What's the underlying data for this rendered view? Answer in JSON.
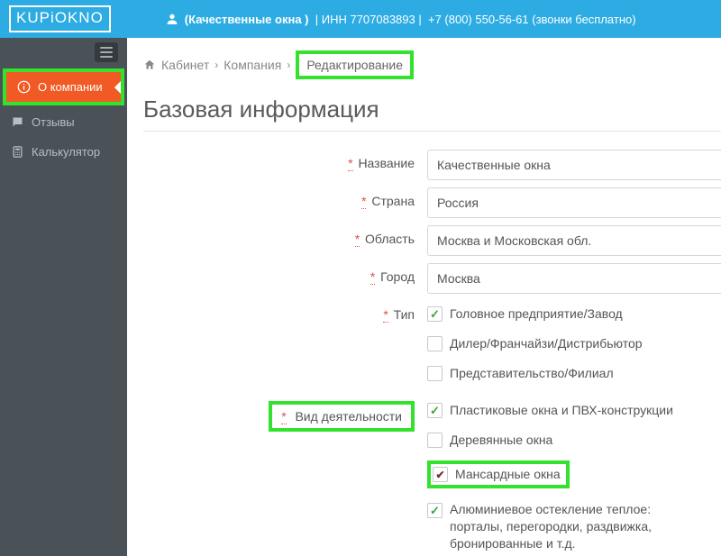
{
  "header": {
    "logo": "KUPiOKNO",
    "company_name": "(Качественные окна )",
    "inn": "ИНН 7707083893",
    "phone": "+7 (800) 550-56-61 (звонки бесплатно)",
    "sep": "|"
  },
  "sidebar": {
    "items": [
      {
        "label": "О компании",
        "icon": "info-icon",
        "active": true
      },
      {
        "label": "Отзывы",
        "icon": "comment-icon",
        "active": false
      },
      {
        "label": "Калькулятор",
        "icon": "calculator-icon",
        "active": false
      }
    ]
  },
  "breadcrumb": {
    "items": [
      "Кабинет",
      "Компания",
      "Редактирование"
    ]
  },
  "page": {
    "title": "Базовая информация"
  },
  "form": {
    "name_label": "Название",
    "name_value": "Качественные окна",
    "country_label": "Страна",
    "country_value": "Россия",
    "region_label": "Область",
    "region_value": "Москва и Московская обл.",
    "city_label": "Город",
    "city_value": "Москва",
    "type_label": "Тип",
    "type_options": [
      {
        "label": "Головное предприятие/Завод",
        "checked": true
      },
      {
        "label": "Дилер/Франчайзи/Дистрибьютор",
        "checked": false
      },
      {
        "label": "Представительство/Филиал",
        "checked": false
      }
    ],
    "activity_label": "Вид деятельности",
    "activity_options": [
      {
        "label": "Пластиковые окна и ПВХ-конструкции",
        "checked": true,
        "highlight": false
      },
      {
        "label": "Деревянные окна",
        "checked": false,
        "highlight": false
      },
      {
        "label": "Мансардные окна",
        "checked": true,
        "highlight": true,
        "brown": true
      },
      {
        "label": "Алюминиевое остекление теплое: порталы, перегородки, раздвижка, бронированные и т.д.",
        "checked": true,
        "highlight": false
      }
    ],
    "required_mark": "*"
  }
}
